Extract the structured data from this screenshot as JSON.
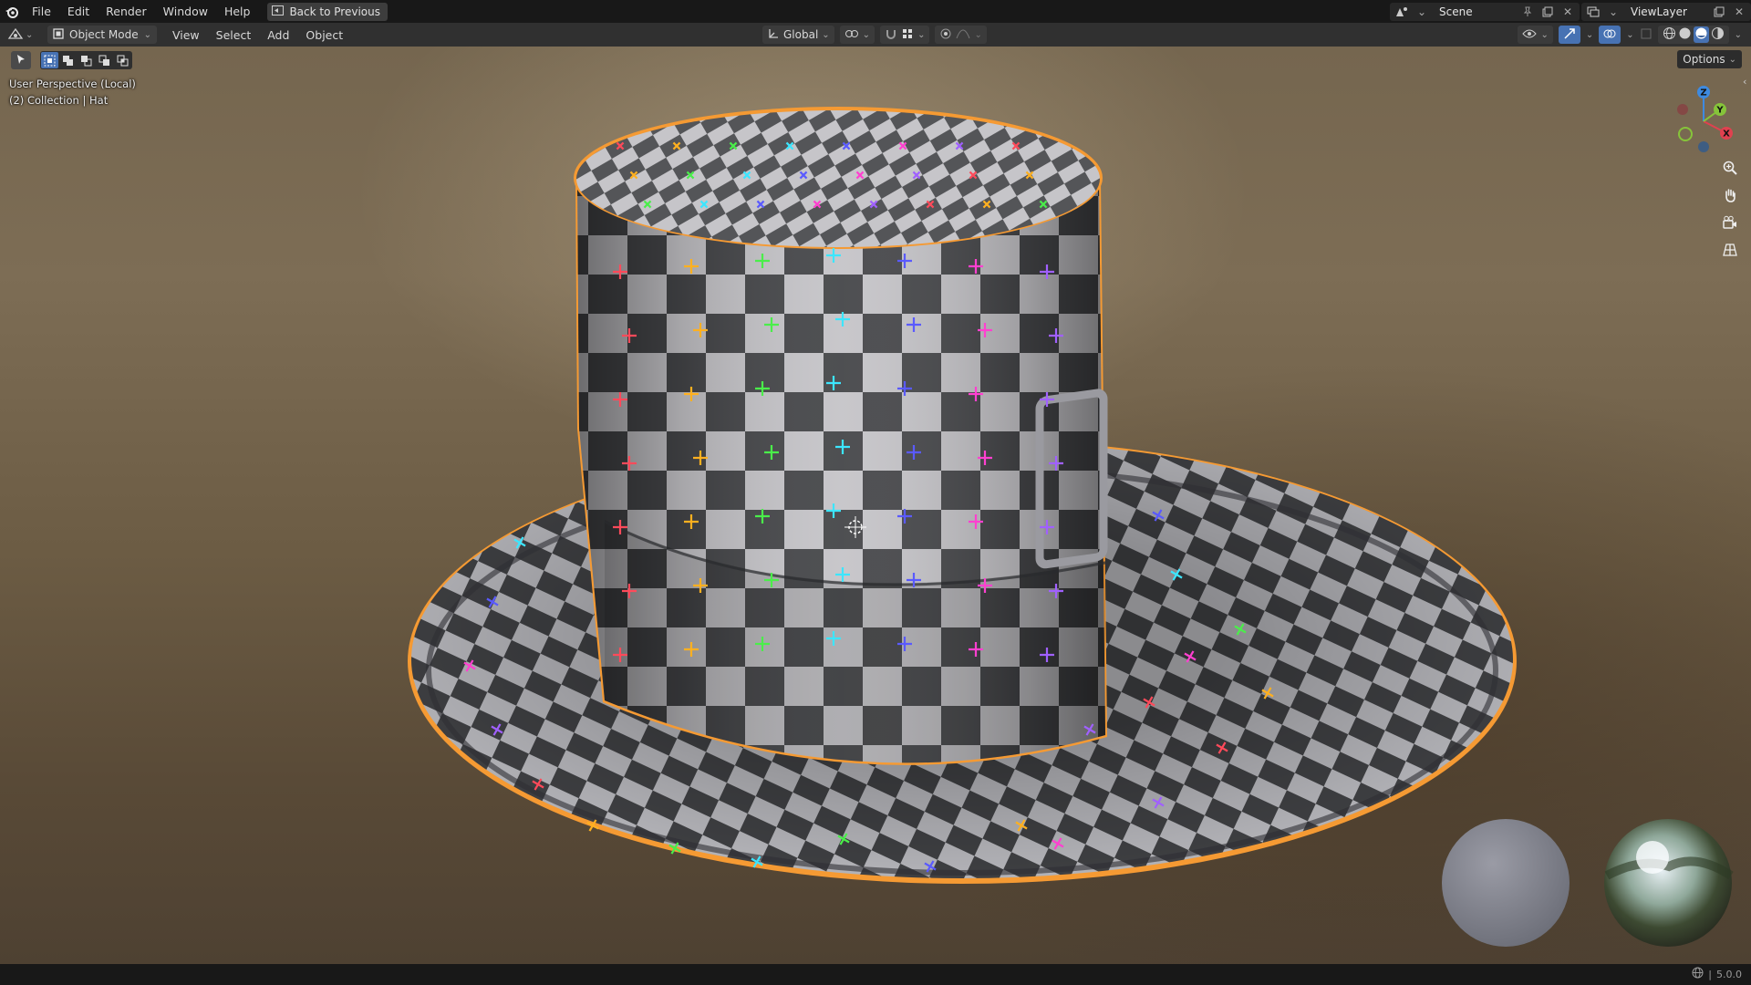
{
  "topbar": {
    "menus": [
      "File",
      "Edit",
      "Render",
      "Window",
      "Help"
    ],
    "back_label": "Back to Previous",
    "scene": "Scene",
    "view_layer": "ViewLayer"
  },
  "header": {
    "mode": "Object Mode",
    "menus": [
      "View",
      "Select",
      "Add",
      "Object"
    ],
    "orientation": "Global"
  },
  "viewport": {
    "perspective_label": "User Perspective (Local)",
    "collection_label": "(2) Collection | Hat",
    "options_label": "Options",
    "gizmo": {
      "x": "X",
      "y": "Y",
      "z": "Z"
    }
  },
  "statusbar": {
    "version": "5.0.0"
  },
  "colors": {
    "accent": "#4772b3",
    "selection_outline": "#f59a33",
    "x_axis": "#e0414f",
    "y_axis": "#86c43a",
    "z_axis": "#3d8ae0"
  }
}
